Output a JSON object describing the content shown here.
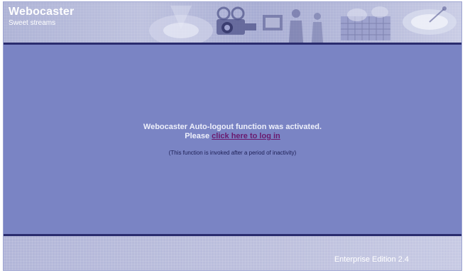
{
  "header": {
    "brand_title": "Webocaster",
    "brand_subtitle": "Sweet streams",
    "banner_image": "media-collage-banner"
  },
  "message": {
    "line1": "Webocaster Auto-logout function was activated.",
    "line2_prefix": "Please ",
    "login_link": "click here to log in",
    "note": "(This function is invoked after a period of inactivity)"
  },
  "footer": {
    "edition": "Enterprise Edition 2.4"
  },
  "colors": {
    "panel": "#7a84c4",
    "banner": "#b7bbdb",
    "rule": "#2a2c6e",
    "link": "#6a1a6e"
  }
}
